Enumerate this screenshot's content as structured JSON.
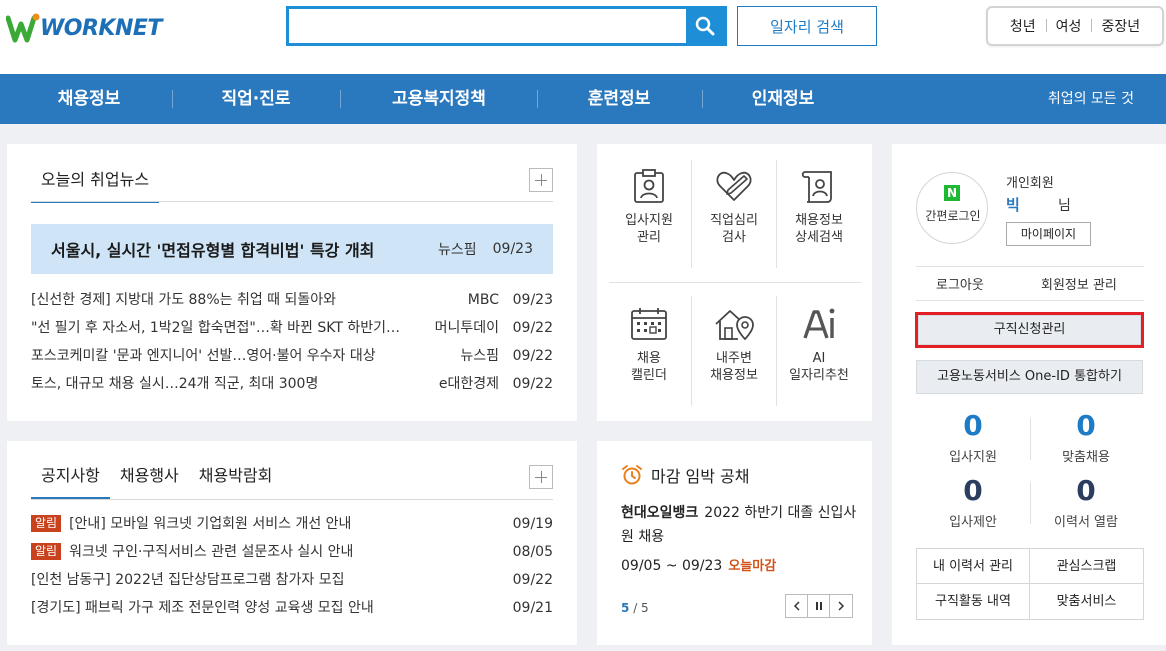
{
  "header": {
    "logo_text": "WORKNET",
    "search_placeholder": "",
    "job_search_label": "일자리 검색",
    "quick_links": [
      "청년",
      "여성",
      "중장년"
    ]
  },
  "gnb": {
    "items": [
      "채용정보",
      "직업·진로",
      "고용복지정책",
      "훈련정보",
      "인재정보"
    ],
    "right_link": "취업의 모든 것"
  },
  "news": {
    "title": "오늘의 취업뉴스",
    "headline": {
      "text": "서울시, 실시간 '면접유형별 합격비법' 특강 개최",
      "source": "뉴스핌",
      "date": "09/23"
    },
    "items": [
      {
        "text": "[신선한 경제] 지방대 가도 88%는 취업 때 되돌아와",
        "source": "MBC",
        "date": "09/23"
      },
      {
        "text": "\"선 필기 후 자소서, 1박2일 합숙면접\"…확 바뀐 SKT 하반기…",
        "source": "머니투데이",
        "date": "09/22"
      },
      {
        "text": "포스코케미칼 '문과 엔지니어' 선발…영어·불어 우수자 대상",
        "source": "뉴스핌",
        "date": "09/22"
      },
      {
        "text": "토스, 대규모 채용 실시…24개 직군, 최대 300명",
        "source": "e대한경제",
        "date": "09/22"
      }
    ]
  },
  "notice": {
    "tabs": [
      "공지사항",
      "채용행사",
      "채용박람회"
    ],
    "badge_label": "알림",
    "items": [
      {
        "badge": true,
        "text": "[안내] 모바일 워크넷 기업회원 서비스 개선 안내",
        "date": "09/19"
      },
      {
        "badge": true,
        "text": "워크넷 구인·구직서비스 관련 설문조사 실시 안내",
        "date": "08/05"
      },
      {
        "badge": false,
        "text": "[인천 남동구] 2022년 집단상담프로그램 참가자 모집",
        "date": "09/22"
      },
      {
        "badge": false,
        "text": "[경기도] 패브릭 가구 제조 전문인력 양성 교육생 모집 안내",
        "date": "09/21"
      }
    ]
  },
  "quick_menu": [
    {
      "label": "입사지원\n관리",
      "icon": "clipboard-user-icon"
    },
    {
      "label": "직업심리\n검사",
      "icon": "heart-pencil-icon"
    },
    {
      "label": "채용정보\n상세검색",
      "icon": "scroll-user-icon"
    },
    {
      "label": "채용\n캘린더",
      "icon": "calendar-icon"
    },
    {
      "label": "내주변\n채용정보",
      "icon": "house-pin-icon"
    },
    {
      "label": "AI\n일자리추천",
      "icon": "ai-icon"
    }
  ],
  "deadline": {
    "title": "마감 임박 공채",
    "company": "현대오일뱅크",
    "description": "2022 하반기 대졸 신입사원 채용",
    "period": "09/05 ~ 09/23",
    "tag": "오늘마감",
    "page_current": "5",
    "page_total": "/ 5"
  },
  "user": {
    "naver_letter": "N",
    "naver_label": "간편로그인",
    "member_type": "개인회원",
    "name": "빅",
    "honorific": "님",
    "mypage_label": "마이페이지",
    "logout_label": "로그아웃",
    "member_info_label": "회원정보 관리",
    "job_request_label": "구직신청관리",
    "oneid_label": "고용노동서비스 One-ID 통합하기",
    "stats": [
      {
        "value": "0",
        "label": "입사지원"
      },
      {
        "value": "0",
        "label": "맞춤채용"
      },
      {
        "value": "0",
        "label": "입사제안"
      },
      {
        "value": "0",
        "label": "이력서 열람"
      }
    ],
    "menu": [
      "내 이력서 관리",
      "관심스크랩",
      "구직활동 내역",
      "맞춤서비스"
    ]
  },
  "colors": {
    "primary": "#2a78be",
    "search_border": "#1e8ed6",
    "stat_blue": "#1e7bc6",
    "stat_navy": "#2c3e60",
    "alert_badge": "#c8421e",
    "deadline_tag": "#d2531a",
    "highlight_box": "#e31f26"
  }
}
